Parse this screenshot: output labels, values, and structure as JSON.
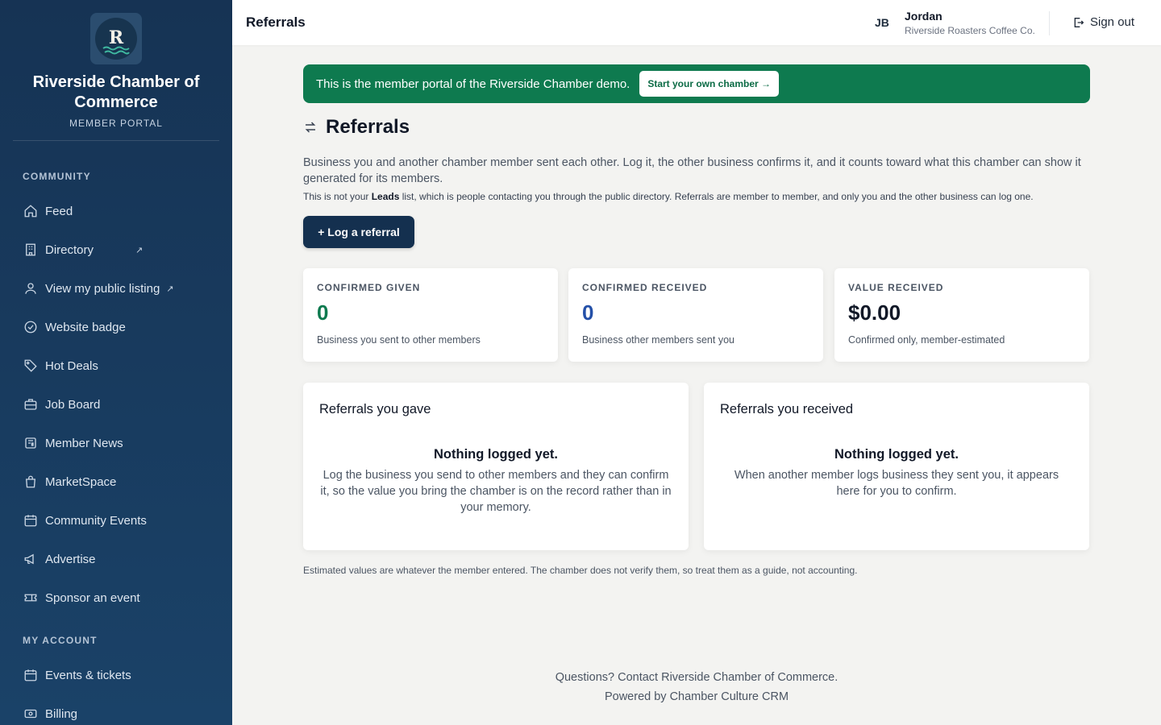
{
  "sidebar": {
    "logo_letter": "R",
    "brand_name": "Riverside Chamber of Commerce",
    "brand_sub": "MEMBER PORTAL",
    "community_label": "COMMUNITY",
    "community_items": [
      {
        "label": "Feed",
        "icon": "home-icon"
      },
      {
        "label": "Directory",
        "icon": "building-icon",
        "external": "↗"
      },
      {
        "label": "View my public listing",
        "icon": "user-icon",
        "external": "↗"
      },
      {
        "label": "Website badge",
        "icon": "check-circle-icon"
      },
      {
        "label": "Hot Deals",
        "icon": "tag-icon"
      },
      {
        "label": "Job Board",
        "icon": "briefcase-icon"
      },
      {
        "label": "Member News",
        "icon": "newspaper-icon"
      },
      {
        "label": "MarketSpace",
        "icon": "shopping-bag-icon"
      },
      {
        "label": "Community Events",
        "icon": "calendar-icon"
      },
      {
        "label": "Advertise",
        "icon": "megaphone-icon"
      },
      {
        "label": "Sponsor an event",
        "icon": "ticket-icon"
      }
    ],
    "account_label": "MY ACCOUNT",
    "account_items": [
      {
        "label": "Events & tickets",
        "icon": "calendar-icon"
      },
      {
        "label": "Billing",
        "icon": "banknote-icon"
      }
    ]
  },
  "topbar": {
    "title": "Referrals",
    "initials": "JB",
    "user_name": "Jordan",
    "user_org": "Riverside Roasters Coffee Co.",
    "signout_label": "Sign out"
  },
  "banner": {
    "text": "This is the member portal of the Riverside Chamber demo.",
    "button_label": "Start your own chamber →"
  },
  "main": {
    "heading": "Referrals",
    "intro": "Business you and another chamber member sent each other. Log it, the other business confirms it, and it counts toward what this chamber can show it generated for its members.",
    "note_pre": "This is not your ",
    "note_bold": "Leads",
    "note_post": " list, which is people contacting you through the public directory. Referrals are member to member, and only you and the other business can log one.",
    "log_button": "+ Log a referral",
    "stats": [
      {
        "label": "CONFIRMED GIVEN",
        "value": "0",
        "desc": "Business you sent to other members",
        "color": "#0e7a4f"
      },
      {
        "label": "CONFIRMED RECEIVED",
        "value": "0",
        "desc": "Business other members sent you",
        "color": "#2450a8"
      },
      {
        "label": "VALUE RECEIVED",
        "value": "$0.00",
        "desc": "Confirmed only, member-estimated",
        "color": "#111827"
      }
    ],
    "panels": [
      {
        "title": "Referrals you gave",
        "empty_title": "Nothing logged yet.",
        "empty_text": "Log the business you send to other members and they can confirm it, so the value you bring the chamber is on the record rather than in your memory."
      },
      {
        "title": "Referrals you received",
        "empty_title": "Nothing logged yet.",
        "empty_text": "When another member logs business they sent you, it appears here for you to confirm."
      }
    ],
    "footnote": "Estimated values are whatever the member entered. The chamber does not verify them, so treat them as a guide, not accounting."
  },
  "footer": {
    "line1": "Questions? Contact Riverside Chamber of Commerce.",
    "line2": "Powered by Chamber Culture CRM"
  }
}
